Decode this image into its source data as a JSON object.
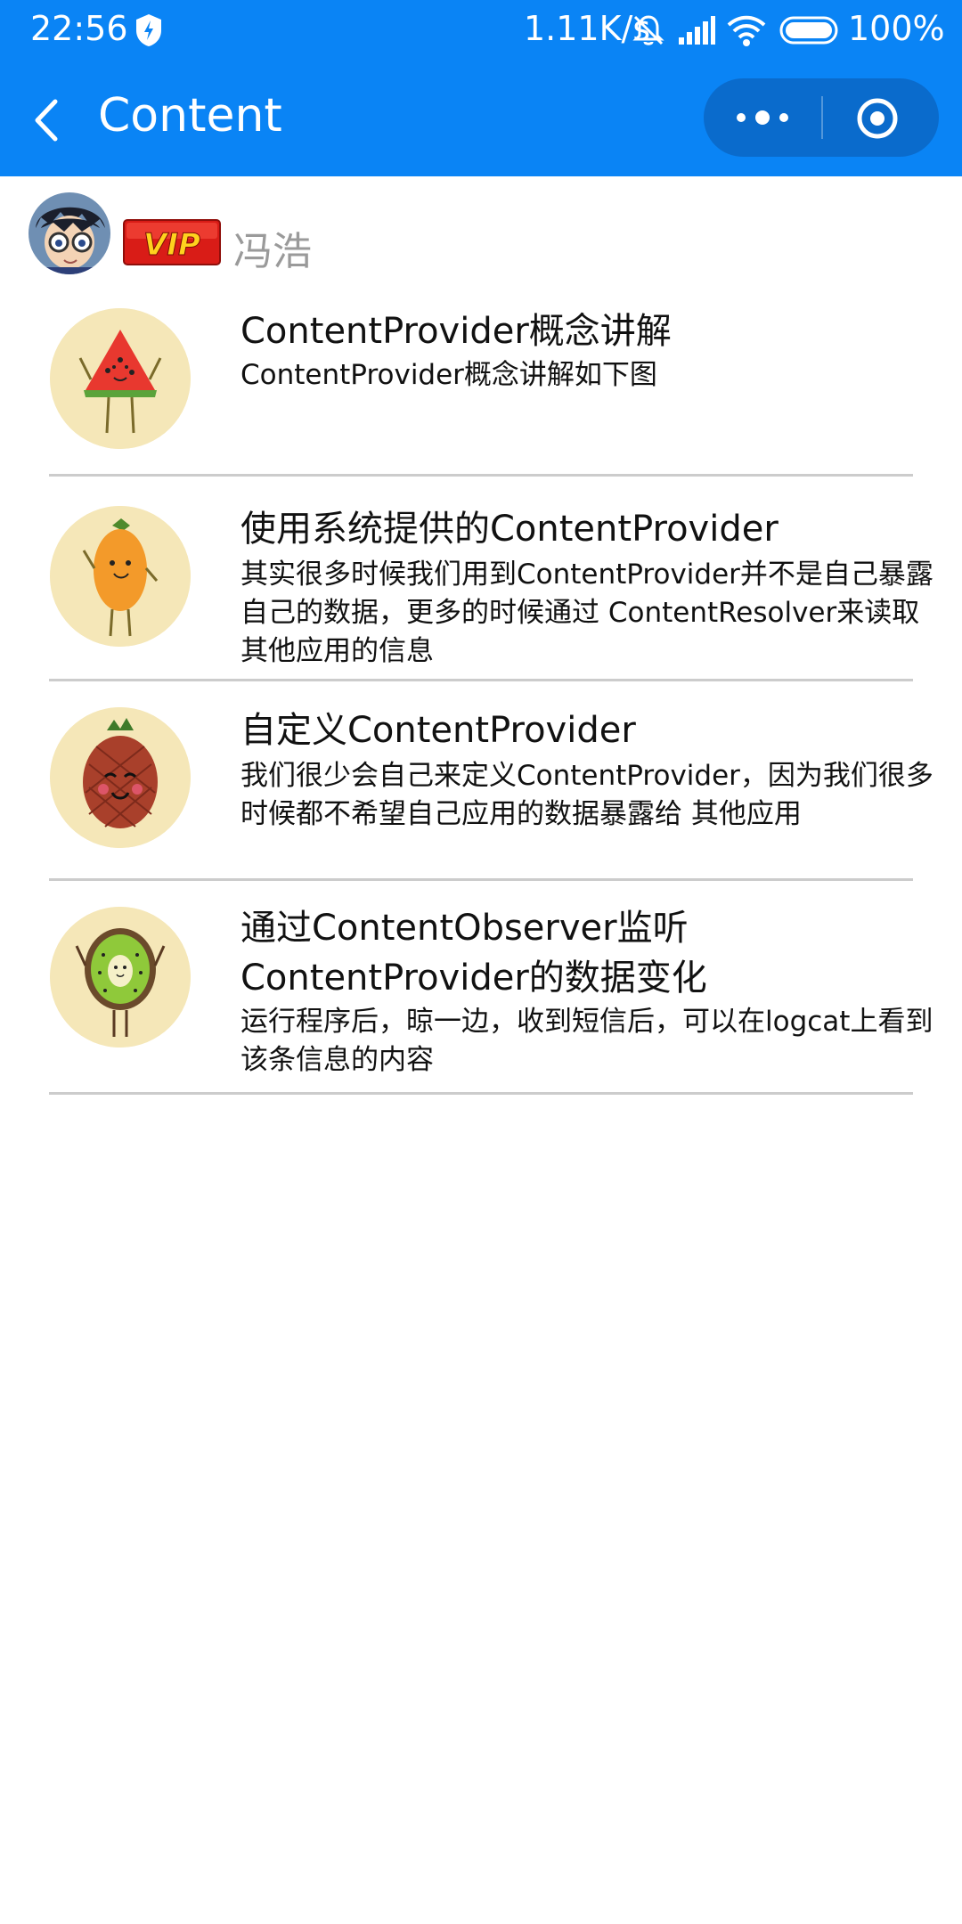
{
  "status_bar": {
    "time": "22:56",
    "net_speed": "1.11K/s",
    "battery": "100%"
  },
  "nav": {
    "title": "Content"
  },
  "user": {
    "badge": "VIP",
    "name": "冯浩"
  },
  "items": [
    {
      "title": " ContentProvider概念讲解",
      "desc": "ContentProvider概念讲解如下图",
      "icon": "watermelon-icon"
    },
    {
      "title": "使用系统提供的ContentProvider",
      "desc": "其实很多时候我们用到ContentProvider并不是自己暴露自己的数据，更多的时候通过 ContentResolver来读取其他应用的信息",
      "icon": "mango-icon"
    },
    {
      "title": "自定义ContentProvider",
      "desc": "我们很少会自己来定义ContentProvider，因为我们很多时候都不希望自己应用的数据暴露给 其他应用",
      "icon": "pineapple-icon"
    },
    {
      "title": "通过ContentObserver监听ContentProvider的数据变化",
      "desc": "运行程序后，晾一边，收到短信后，可以在logcat上看到该条信息的内容",
      "icon": "kiwi-icon"
    }
  ],
  "colors": {
    "header": "#0A84F5",
    "capsule": "#0A6BCC",
    "separator": "#cccccc",
    "thumb_bg": "#F5E7B8"
  }
}
